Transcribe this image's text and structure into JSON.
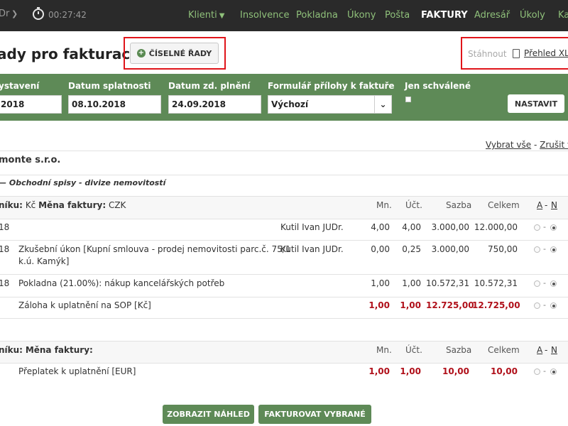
{
  "topbar": {
    "user": "Dr",
    "timer": "00:27:42",
    "nav": [
      {
        "label": "Klienti",
        "dropdown": true
      },
      {
        "label": "Insolvence"
      },
      {
        "label": "Pokladna"
      },
      {
        "label": "Úkony"
      },
      {
        "label": "Pošta"
      },
      {
        "label": "FAKTURY",
        "active": true
      },
      {
        "label": "Adresář"
      },
      {
        "label": "Úkoly"
      },
      {
        "label": "Kal"
      }
    ]
  },
  "header": {
    "title": "ady pro fakturaci",
    "series_button": "ČÍSELNÉ ŘADY",
    "download_label": "Stáhnout",
    "xls_link": "Přehled XLS"
  },
  "filters": {
    "issued_label": "ystavení",
    "issued_value": "2018",
    "due_label": "Datum splatnosti",
    "due_value": "08.10.2018",
    "tax_label": "Datum zd. plnění",
    "tax_value": "24.09.2018",
    "form_label": "Formulář přílohy k faktuře",
    "form_value": "Výchozí",
    "approved_label": "Jen schválené",
    "approved_checked": false,
    "set_button": "NASTAVIT"
  },
  "select": {
    "select_all": "Vybrat vše",
    "sep": "-",
    "cancel_all": "Zrušit vš"
  },
  "client": "monte s.r.o.",
  "case_title": "Obchodní spisy - divize nemovitostí",
  "groups": [
    {
      "header_label": "níku:",
      "header_value": "Kč",
      "currency_label": "Měna faktury:",
      "currency_value": "CZK",
      "cols": {
        "mn": "Mn.",
        "uct": "Účt.",
        "sazba": "Sazba",
        "celkem": "Celkem",
        "a": "A",
        "dash": "-",
        "n": "N"
      },
      "rows": [
        {
          "date": "18",
          "desc": "",
          "person": "Kutil Ivan JUDr.",
          "mn": "4,00",
          "uct": "4,00",
          "sazba": "3.000,00",
          "celkem": "12.000,00",
          "selected": "N"
        },
        {
          "date": "18",
          "desc": "Zkušební úkon [Kupní smlouva - prodej nemovitosti parc.č. 75/1",
          "desc2": "k.ú. Kamýk]",
          "person": "Kutil Ivan JUDr.",
          "mn": "0,00",
          "uct": "0,25",
          "sazba": "3.000,00",
          "celkem": "750,00",
          "selected": "N"
        },
        {
          "date": "18",
          "desc": "Pokladna (21.00%): nákup kancelářských potřeb",
          "person": "",
          "mn": "1,00",
          "uct": "1,00",
          "sazba": "10.572,31",
          "celkem": "10.572,31",
          "selected": "N"
        },
        {
          "date": "",
          "desc": "Záloha k uplatnění na SOP [Kč]",
          "person": "",
          "mn": "1,00",
          "uct": "1,00",
          "sazba": "12.725,00",
          "celkem": "12.725,00",
          "selected": "N",
          "red": true
        }
      ]
    },
    {
      "header_label": "níku:",
      "header_value": "",
      "currency_label": "Měna faktury:",
      "currency_value": "",
      "cols": {
        "mn": "Mn.",
        "uct": "Účt.",
        "sazba": "Sazba",
        "celkem": "Celkem",
        "a": "A",
        "dash": "-",
        "n": "N"
      },
      "rows": [
        {
          "date": "",
          "desc": "Přeplatek k uplatnění [EUR]",
          "person": "",
          "mn": "1,00",
          "uct": "1,00",
          "sazba": "10,00",
          "celkem": "10,00",
          "selected": "N",
          "red": true
        }
      ]
    }
  ],
  "actions": {
    "preview": "ZOBRAZIT NÁHLED",
    "invoice": "FAKTUROVAT VYBRANÉ"
  },
  "colors": {
    "nav_bg": "#2a2a2a",
    "nav_link": "#8fc07a",
    "filter_bg": "#5e8a57",
    "highlight_red": "#e0141a",
    "value_red": "#b0101a"
  }
}
